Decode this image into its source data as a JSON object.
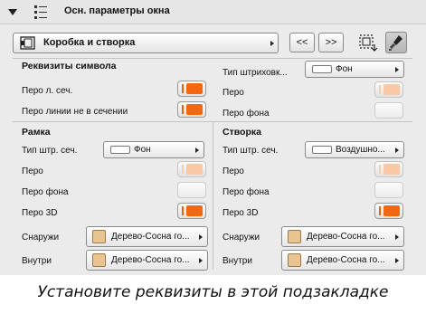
{
  "header": {
    "title": "Осн. параметры окна"
  },
  "toolbar": {
    "selector_label": "Коробка и створка",
    "prev_label": "<<",
    "next_label": ">>"
  },
  "symbol_attrs": {
    "title": "Реквизиты символа",
    "cut_pen_label": "Перо л. сеч.",
    "uncut_pen_label": "Перо линии не в сечении",
    "hatch_type_label": "Тип штриховк...",
    "hatch_type_value": "Фон",
    "pen_label": "Перо",
    "bg_pen_label": "Перо фона"
  },
  "frame": {
    "title": "Рамка",
    "hatch_type_label": "Тип штр. сеч.",
    "hatch_type_value": "Фон",
    "pen_label": "Перо",
    "bg_pen_label": "Перо фона",
    "pen3d_label": "Перо 3D",
    "outside_label": "Снаружи",
    "outside_value": "Дерево-Сосна го...",
    "inside_label": "Внутри",
    "inside_value": "Дерево-Сосна го..."
  },
  "sash": {
    "title": "Створка",
    "hatch_type_label": "Тип штр. сеч.",
    "hatch_type_value": "Воздушно...",
    "pen_label": "Перо",
    "bg_pen_label": "Перо фона",
    "pen3d_label": "Перо 3D",
    "outside_label": "Снаружи",
    "outside_value": "Дерево-Сосна го...",
    "inside_label": "Внутри",
    "inside_value": "Дерево-Сосна го..."
  },
  "caption": "Установите реквизиты в этой подзакладке",
  "colors": {
    "pen_orange": "#f3680f",
    "material_wood": "#e9c48f"
  }
}
